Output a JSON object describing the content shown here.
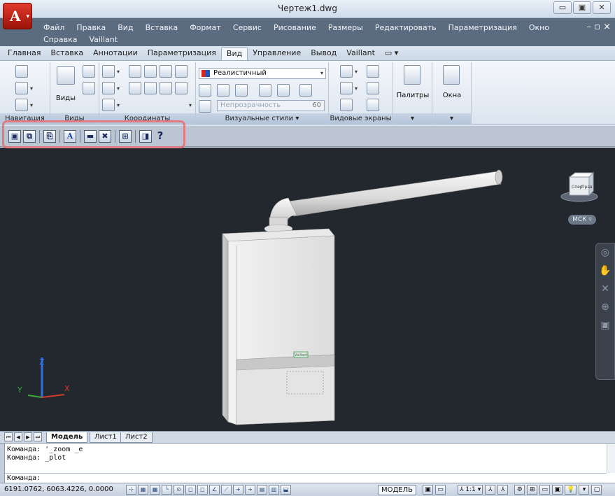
{
  "window": {
    "title": "Чертеж1.dwg",
    "controls": [
      "▭",
      "▣",
      "✕"
    ]
  },
  "menu": {
    "row1": [
      "Файл",
      "Правка",
      "Вид",
      "Вставка",
      "Формат",
      "Сервис",
      "Рисование",
      "Размеры",
      "Редактировать",
      "Параметризация",
      "Окно"
    ],
    "row2": [
      "Справка",
      "Vaillant"
    ],
    "doc_controls": "– ▫ ×"
  },
  "ribbon_tabs": [
    "Главная",
    "Вставка",
    "Аннотации",
    "Параметризация",
    "Вид",
    "Управление",
    "Вывод",
    "Vaillant",
    "▭ ▾"
  ],
  "ribbon_active_tab": "Вид",
  "ribbon": {
    "views_label": "Виды",
    "panel_navigation": "Навигация",
    "panel_views": "Виды",
    "panel_coords": "Координаты",
    "visual_style_value": "Реалистичный",
    "opacity_label": "Непрозрачность",
    "opacity_value": "60",
    "panel_visual_styles": "Визуальные стили ▾",
    "panel_viewports": "Видовые экраны",
    "palettes_label": "Палитры",
    "windows_label": "Окна",
    "expand": "▾"
  },
  "toolbar": {
    "buttons": [
      "▣",
      "⧉",
      "⎘",
      "A",
      "▬",
      "✖",
      "⊞",
      "◨",
      "?"
    ]
  },
  "viewport": {
    "ucs_label": "МСК ▿",
    "viewcube_front": "Спер",
    "viewcube_right": "Прав",
    "axis_x": "X",
    "axis_y": "Y",
    "axis_z": "Z",
    "boiler_label": "Vaillant"
  },
  "layout_tabs": {
    "nav": [
      "⏮",
      "◀",
      "▶",
      "⏭"
    ],
    "tabs": [
      "Модель",
      "Лист1",
      "Лист2"
    ]
  },
  "command_line": {
    "history": [
      "Команда: '_zoom _e",
      "Команда: _plot"
    ],
    "prompt": "Команда:"
  },
  "status_bar": {
    "coordinates": "6191.0762, 6063.4226, 0.0000",
    "mode_buttons": [
      "⊹",
      "▦",
      "▦",
      "└",
      "⊙",
      "◻",
      "◻",
      "∠",
      "⟋",
      "+",
      "+",
      "▤",
      "▥",
      "⬓"
    ],
    "space": "МОДЕЛЬ",
    "right_buttons": [
      "▣",
      "▭",
      "⅄ 1:1 ▾",
      "⅄",
      "⅄",
      "⚙",
      "⊞",
      "▭",
      "▣",
      "💡",
      "▾",
      "▢"
    ]
  },
  "colors": {
    "viewport_bg": "#23282f",
    "highlight": "#e07a83",
    "menubar_bg": "#5b6b80"
  }
}
